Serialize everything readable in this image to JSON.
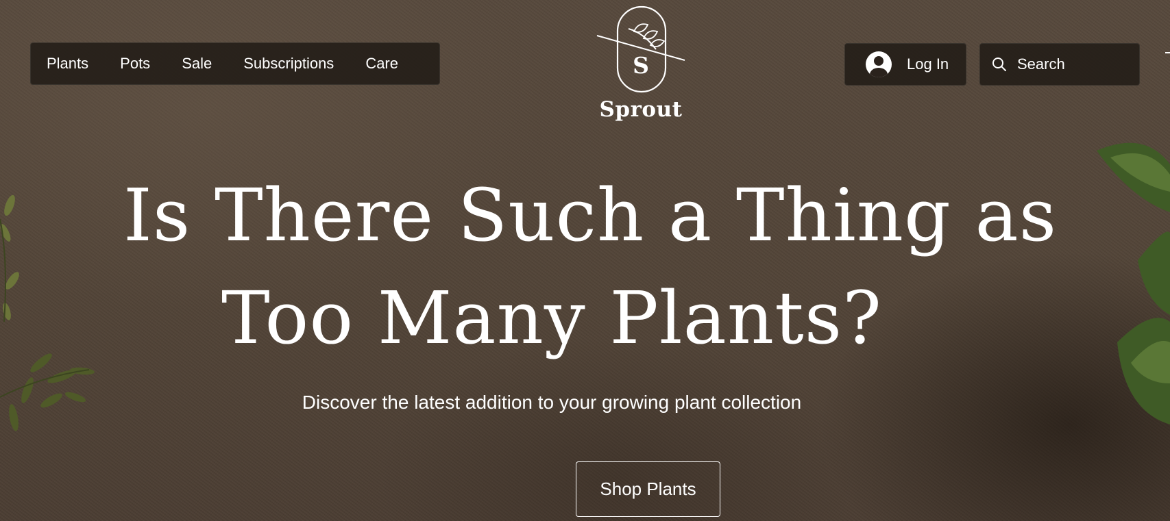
{
  "nav": {
    "items": [
      {
        "label": "Plants"
      },
      {
        "label": "Pots"
      },
      {
        "label": "Sale"
      },
      {
        "label": "Subscriptions"
      },
      {
        "label": "Care"
      }
    ]
  },
  "logo": {
    "letter": "S",
    "name": "Sprout",
    "icon": "sprout-leaf-icon"
  },
  "account": {
    "login_label": "Log In",
    "icon": "user-avatar-icon"
  },
  "search": {
    "placeholder": "Search",
    "icon": "search-icon"
  },
  "hero": {
    "title_line1": "Is There Such a Thing as",
    "title_line2": "Too Many Plants?",
    "subtitle": "Discover the latest addition to your growing plant collection",
    "cta_label": "Shop Plants"
  },
  "colors": {
    "background": "#5c4d3f",
    "nav_background": "#221c17",
    "text": "#ffffff"
  }
}
